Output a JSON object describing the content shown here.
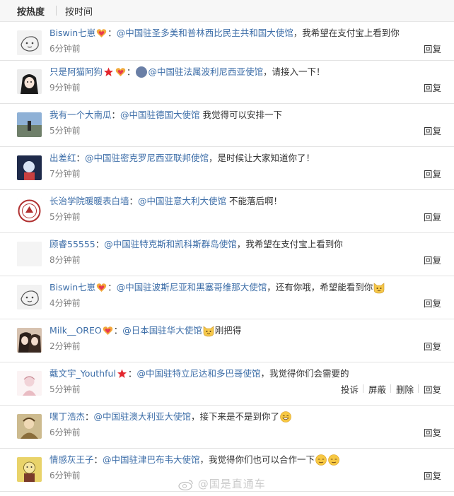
{
  "sort_tabs": [
    {
      "label": "按热度",
      "active": true
    },
    {
      "label": "按时间",
      "active": false
    }
  ],
  "comments": [
    {
      "user": "Biswin七崽",
      "badges": [
        "heart-badge"
      ],
      "sep": "：",
      "mention": "@中国驻圣多美和普林西比民主共和国大使馆",
      "text": "，我希望在支付宝上看到你",
      "time": "6分钟前",
      "actions": [
        "回复"
      ]
    },
    {
      "user": "只是阿猫阿狗",
      "badges": [
        "red-star-badge",
        "heart-badge"
      ],
      "sep": "：",
      "mention": "@中国驻法属波利尼西亚使馆",
      "text": "，请接入一下！",
      "time": "9分钟前",
      "actions": [
        "回复"
      ]
    },
    {
      "user": "我有一个大南瓜",
      "badges": [],
      "sep": "：",
      "mention": "@中国驻德国大使馆",
      "text": " 我觉得可以安排一下",
      "time": "5分钟前",
      "actions": [
        "回复"
      ]
    },
    {
      "user": "出差红",
      "badges": [],
      "sep": "：",
      "mention": "@中国驻密克罗尼西亚联邦使馆",
      "text": "，是时候让大家知道你了！",
      "time": "7分钟前",
      "actions": [
        "回复"
      ]
    },
    {
      "user": "长治学院暖暖表白墙",
      "badges": [],
      "sep": "：",
      "mention": "@中国驻意大利大使馆",
      "text": " 不能落后啊！",
      "time": "5分钟前",
      "actions": [
        "回复"
      ]
    },
    {
      "user": "顾睿55555",
      "badges": [],
      "sep": "：",
      "mention": "@中国驻特克斯和凯科斯群岛使馆",
      "text": "，我希望在支付宝上看到你",
      "time": "8分钟前",
      "actions": [
        "回复"
      ]
    },
    {
      "user": "Biswin七崽",
      "badges": [
        "heart-badge"
      ],
      "sep": "：",
      "mention": "@中国驻波斯尼亚和黑塞哥维那大使馆",
      "text": "，还有你哦，希望能看到你",
      "time": "4分钟前",
      "actions": [
        "回复"
      ]
    },
    {
      "user": "Milk__OREO",
      "badges": [
        "heart-badge"
      ],
      "sep": "：",
      "mention": "@日本国驻华大使馆",
      "text": "刚把得",
      "time": "2分钟前",
      "actions": [
        "回复"
      ]
    },
    {
      "user": "戴文宇_Youthful",
      "badges": [
        "red-star-badge"
      ],
      "sep": "：",
      "mention": "@中国驻特立尼达和多巴哥使馆",
      "text": "，我觉得你们会需要的",
      "time": "5分钟前",
      "actions": [
        "投诉",
        "屏蔽",
        "删除",
        "回复"
      ]
    },
    {
      "user": "嘿丁浩杰",
      "badges": [],
      "sep": "：",
      "mention": "@中国驻澳大利亚大使馆",
      "text": "，接下来是不是到你了",
      "time": "6分钟前",
      "actions": [
        "回复"
      ]
    },
    {
      "user": "情感灰王子",
      "badges": [],
      "sep": "：",
      "mention": "@中国驻津巴布韦大使馆",
      "text": "，我觉得你们也可以合作一下",
      "time": "6分钟前",
      "actions": [
        "回复"
      ]
    }
  ],
  "watermark": "@国是直通车"
}
